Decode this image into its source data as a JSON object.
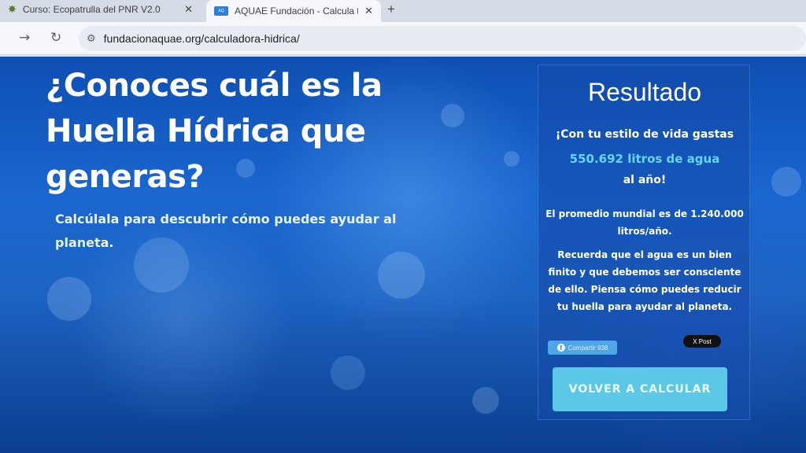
{
  "browser": {
    "tabs": [
      {
        "title": "Curso: Ecopatrulla del PNR V2.0",
        "icon": "bug-icon",
        "active": false
      },
      {
        "title": "AQUAE Fundación - Calcula tu H",
        "icon": "aquae-favicon",
        "active": true
      }
    ],
    "url": "fundacionaquae.org/calculadora-hidrica/"
  },
  "hero": {
    "headline": "¿Conoces cuál es la Huella Hídrica que generas?",
    "subtitle": "Calcúlala para descubrir cómo puedes ayudar al planeta."
  },
  "result": {
    "title": "Resultado",
    "line1": "¡Con tu estilo de vida gastas",
    "amount": "550.692 litros de agua",
    "line3": "al año!",
    "world_average": "El promedio mundial es de 1.240.000 litros/año.",
    "reminder": "Recuerda que el agua es un bien finito y que debemos ser consciente de ello. Piensa cómo puedes reducir tu huella para ayudar al planeta.",
    "share_label": "Compartir 938",
    "xpost_label": "X Post",
    "recalc_label": "VOLVER A CALCULAR"
  },
  "colors": {
    "accent": "#62d6f4",
    "button": "#5cc8e8",
    "background": "#1a66d0"
  }
}
